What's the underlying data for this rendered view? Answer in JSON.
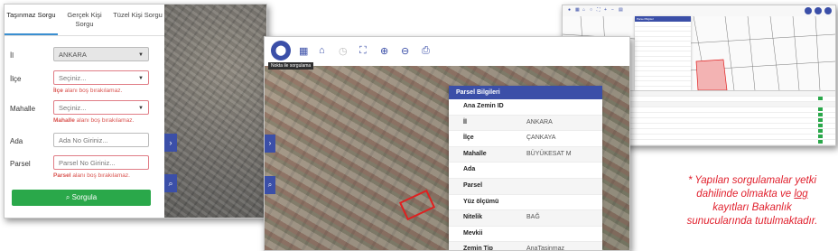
{
  "query_form": {
    "tabs": [
      "Taşınmaz Sorgu",
      "Gerçek Kişi Sorgu",
      "Tüzel Kişi Sorgu"
    ],
    "fields": [
      {
        "label": "İl",
        "value": "ANKARA",
        "error": ""
      },
      {
        "label": "İlçe",
        "placeholder": "Seçiniz...",
        "error_bold": "İlçe",
        "error_rest": "alanı boş bırakılamaz."
      },
      {
        "label": "Mahalle",
        "placeholder": "Seçiniz...",
        "error_bold": "Mahalle",
        "error_rest": "alanı boş bırakılamaz."
      },
      {
        "label": "Ada",
        "placeholder": "Ada No Giriniz..."
      },
      {
        "label": "Parsel",
        "placeholder": "Parsel No Giriniz...",
        "error_bold": "Parsel",
        "error_rest": "alanı boş bırakılamaz."
      }
    ],
    "submit_label": "Sorgula",
    "accent_color": "#2aa84a"
  },
  "parcel_map": {
    "toolbar_icons": [
      "location-pin-icon",
      "map-icon",
      "home-icon",
      "history-icon",
      "fullscreen-icon",
      "zoom-in-icon",
      "zoom-out-icon",
      "print-icon"
    ],
    "badge": "Nokta ile sorgulama",
    "panel_title": "Parsel Bilgileri",
    "rows": [
      {
        "key": "Ana Zemin ID",
        "value": ""
      },
      {
        "key": "İl",
        "value": "ANKARA"
      },
      {
        "key": "İlçe",
        "value": "ÇANKAYA"
      },
      {
        "key": "Mahalle",
        "value": "BÜYÜKESAT M"
      },
      {
        "key": "Ada",
        "value": ""
      },
      {
        "key": "Parsel",
        "value": ""
      },
      {
        "key": "Yüz ölçümü",
        "value": ""
      },
      {
        "key": "Nitelik",
        "value": "BAĞ"
      },
      {
        "key": "Mevkii",
        "value": ""
      },
      {
        "key": "Zemin Tip",
        "value": "AnaTasinmaz"
      }
    ],
    "brand_color": "#3b4fa8"
  },
  "log_view": {
    "panel_title": "Parsel Bilgileri"
  },
  "note": {
    "line1": "* Yapılan sorgulamalar yetki",
    "line2_pre": "dahilinde olmakta ve ",
    "line2_under": "log",
    "line3": "kayıtları Bakanlık",
    "line4": "sunucularında tutulmaktadır.",
    "color": "#e01e2b"
  }
}
